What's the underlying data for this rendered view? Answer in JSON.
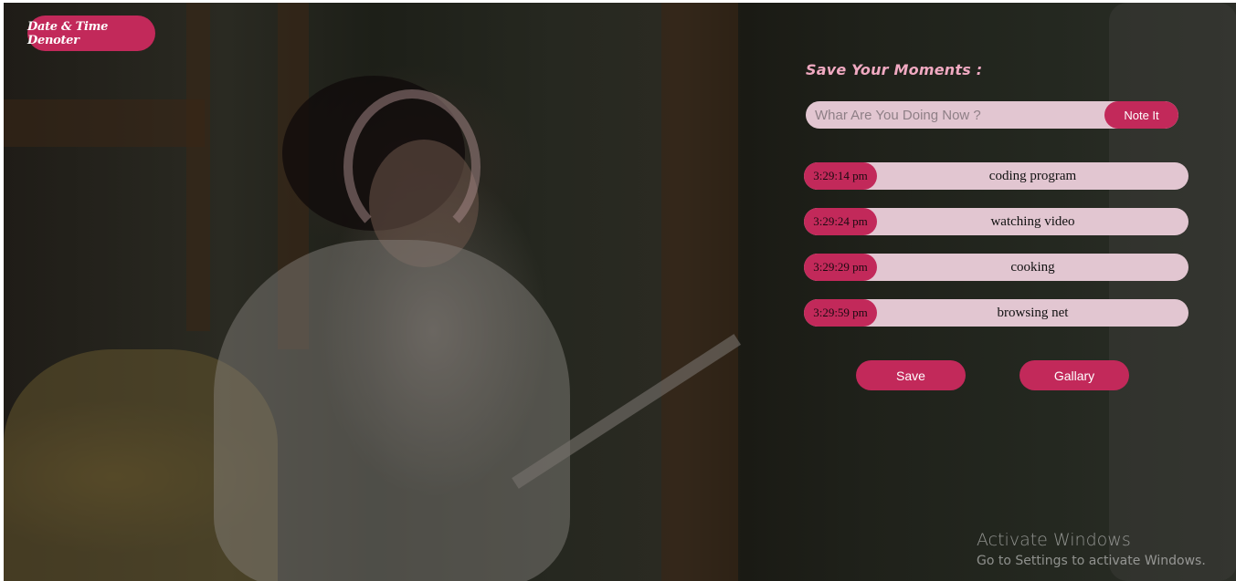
{
  "logo": {
    "label": "Date & Time Denoter"
  },
  "panel": {
    "title": "Save Your Moments :",
    "input_placeholder": "Whar Are You Doing Now ?",
    "input_value": "",
    "note_button": "Note It"
  },
  "moments": [
    {
      "time": "3:29:14 pm",
      "text": "coding program"
    },
    {
      "time": "3:29:24 pm",
      "text": "watching video"
    },
    {
      "time": "3:29:29 pm",
      "text": "cooking"
    },
    {
      "time": "3:29:59 pm",
      "text": "browsing net"
    }
  ],
  "actions": {
    "save": "Save",
    "gallery": "Gallary"
  },
  "watermark": {
    "title": "Activate Windows",
    "subtitle": "Go to Settings to activate Windows."
  },
  "colors": {
    "accent": "#c2295a",
    "pill": "#e2c6d1",
    "title": "#f0a9c1"
  }
}
